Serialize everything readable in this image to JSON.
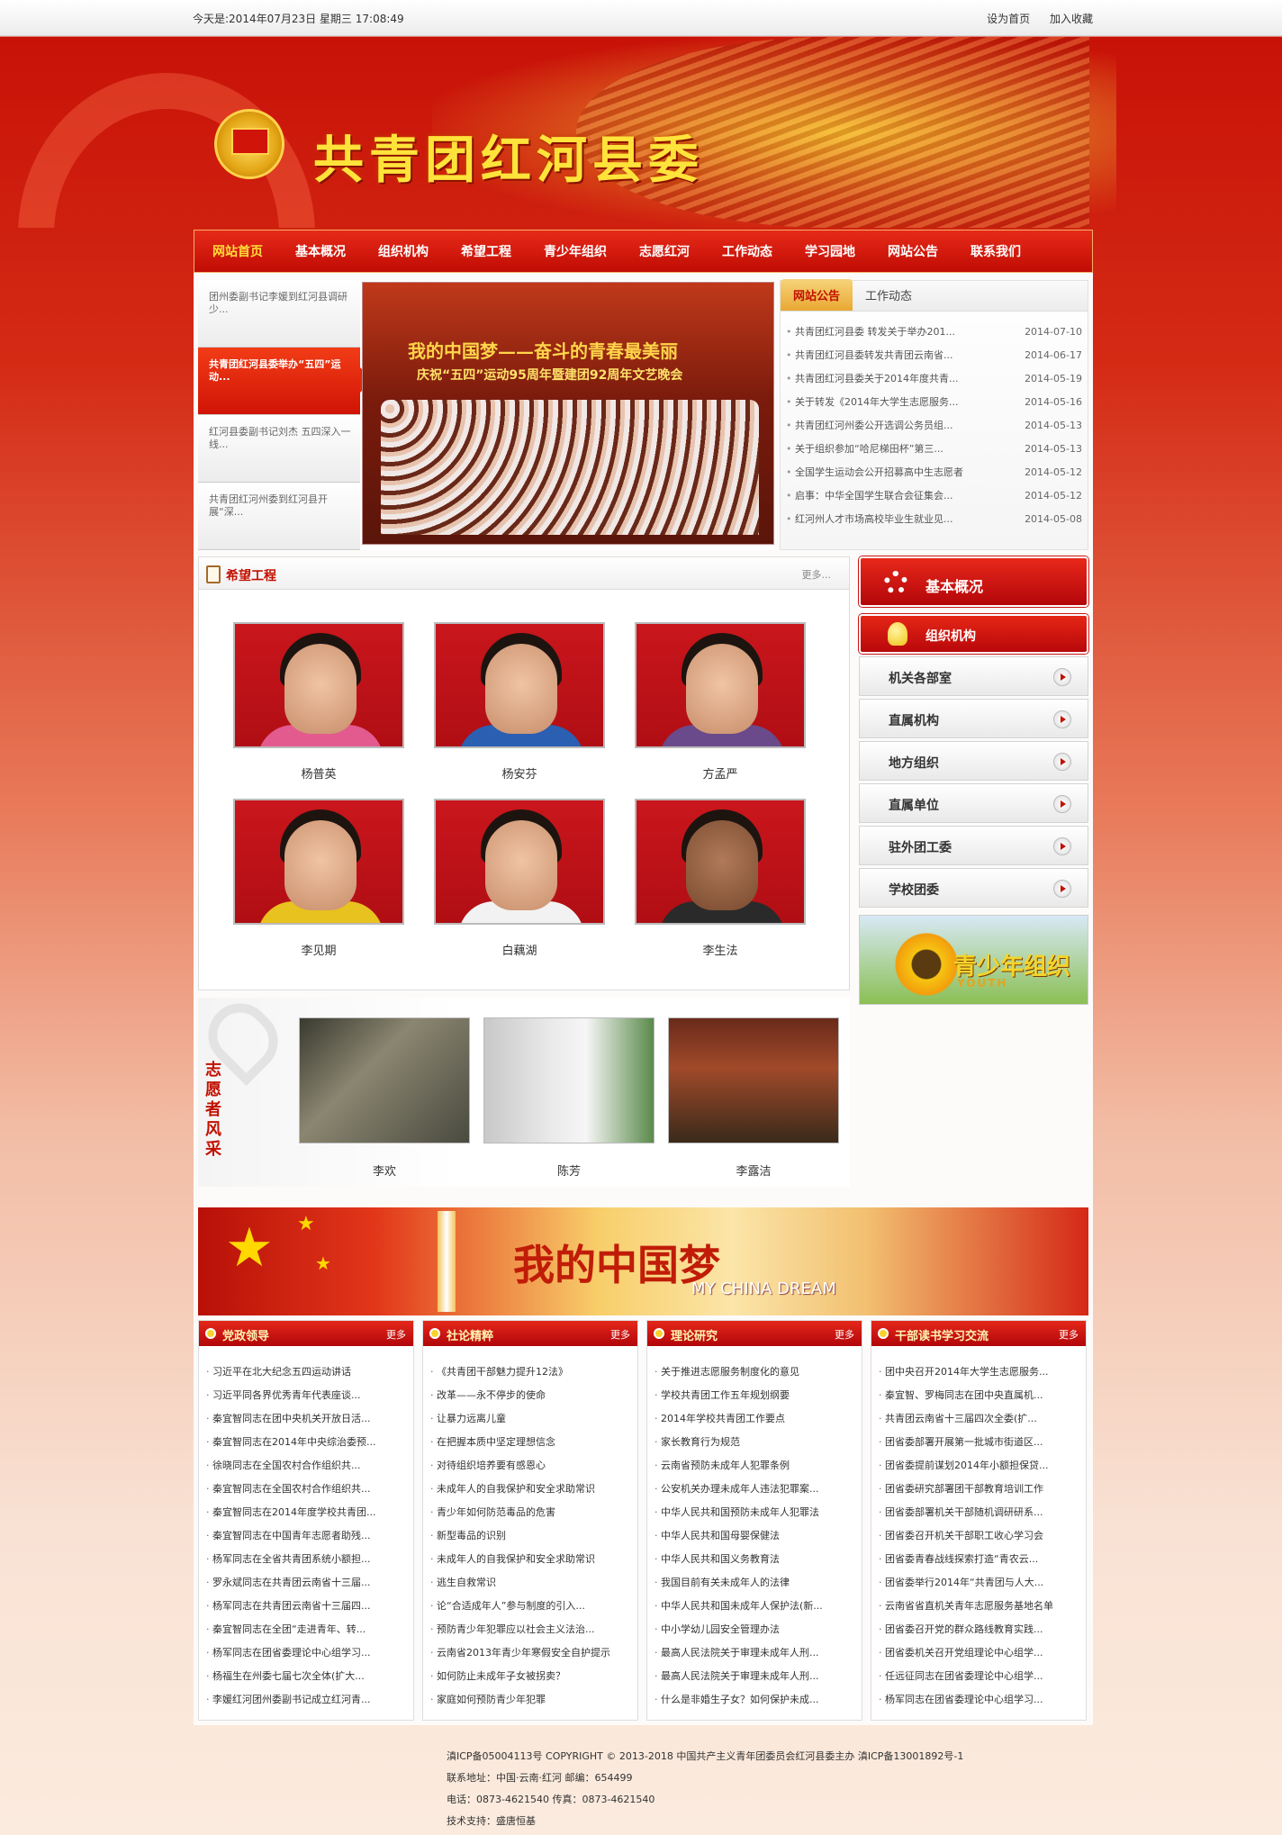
{
  "topbar": {
    "date": "今天是:2014年07月23日  星期三  17:08:49",
    "set_home": "设为首页",
    "add_fav": "加入收藏"
  },
  "banner": {
    "title": "共青团红河县委"
  },
  "nav": [
    "网站首页",
    "基本概况",
    "组织机构",
    "希望工程",
    "青少年组织",
    "志愿红河",
    "工作动态",
    "学习园地",
    "网站公告",
    "联系我们"
  ],
  "slider": {
    "thumbs": [
      "团州委副书记李媛到红河县调研少...",
      "共青团红河县委举办“五四”运动...",
      "红河县委副书记刘杰 五四深入一线...",
      "共青团红河州委到红河县开展“深..."
    ],
    "slogan": "我的中国梦——奋斗的青春最美丽",
    "subslogan": "庆祝“五四”运动95周年暨建团92周年文艺晚会"
  },
  "notice": {
    "tabs": [
      "网站公告",
      "工作动态"
    ],
    "items": [
      {
        "t": "共青团红河县委 转发关于举办201...",
        "d": "2014-07-10"
      },
      {
        "t": "共青团红河县委转发共青团云南省...",
        "d": "2014-06-17"
      },
      {
        "t": "共青团红河县委关于2014年度共青...",
        "d": "2014-05-19"
      },
      {
        "t": "关于转发《2014年大学生志愿服务...",
        "d": "2014-05-16"
      },
      {
        "t": "共青团红河州委公开选调公务员组...",
        "d": "2014-05-13"
      },
      {
        "t": "关于组织参加“哈尼梯田杯”第三...",
        "d": "2014-05-13"
      },
      {
        "t": "全国学生运动会公开招募高中生志愿者",
        "d": "2014-05-12"
      },
      {
        "t": "启事：中华全国学生联合会征集会...",
        "d": "2014-05-12"
      },
      {
        "t": "红河州人才市场高校毕业生就业见...",
        "d": "2014-05-08"
      }
    ]
  },
  "hope": {
    "title": "希望工程",
    "more": "更多...",
    "kids": [
      "杨普英",
      "杨安芬",
      "方孟严",
      "李见期",
      "白藕湖",
      "李生法"
    ]
  },
  "volunteer": {
    "label": "志愿者风采",
    "people": [
      "李欢",
      "陈芳",
      "李露洁"
    ]
  },
  "side": {
    "basic": "基本概况",
    "org": "组织机构",
    "items": [
      "机关各部室",
      "直属机构",
      "地方组织",
      "直属单位",
      "驻外团工委",
      "学校团委"
    ],
    "youth": "青少年组织",
    "youth_en": "YOUTH"
  },
  "dream": {
    "title": "我的中国梦",
    "en": "MY CHINA DREAM"
  },
  "columns": [
    {
      "title": "党政领导",
      "more": "更多",
      "items": [
        "习近平在北大纪念五四运动讲话",
        "习近平同各界优秀青年代表座谈...",
        "秦宜智同志在团中央机关开放日活...",
        "秦宜智同志在2014年中央综治委预...",
        "徐晓同志在全国农村合作组织共...",
        "秦宜智同志在全国农村合作组织共...",
        "秦宜智同志在2014年度学校共青团...",
        "秦宜智同志在中国青年志愿者助残...",
        "杨军同志在全省共青团系统小额担...",
        "罗永斌同志在共青团云南省十三届...",
        "杨军同志在共青团云南省十三届四...",
        "秦宜智同志在全团“走进青年、转...",
        "杨军同志在团省委理论中心组学习...",
        "杨福生在州委七届七次全体(扩大...",
        "李媛红河团州委副书记成立红河青..."
      ]
    },
    {
      "title": "社论精粹",
      "more": "更多",
      "items": [
        "《共青团干部魅力提升12法》",
        "改革——永不停步的使命",
        "让暴力远离儿童",
        "在把握本质中坚定理想信念",
        "对待组织培养要有感恩心",
        "未成年人的自我保护和安全求助常识",
        "青少年如何防范毒品的危害",
        "新型毒品的识别",
        "未成年人的自我保护和安全求助常识",
        "逃生自救常识",
        "论“合适成年人”参与制度的引入...",
        "预防青少年犯罪应以社会主义法治...",
        "云南省2013年青少年寒假安全自护提示",
        "如何防止未成年子女被拐卖？",
        "家庭如何预防青少年犯罪"
      ]
    },
    {
      "title": "理论研究",
      "more": "更多",
      "items": [
        "关于推进志愿服务制度化的意见",
        "学校共青团工作五年规划纲要",
        "2014年学校共青团工作要点",
        "家长教育行为规范",
        "云南省预防未成年人犯罪条例",
        "公安机关办理未成年人违法犯罪案...",
        "中华人民共和国预防未成年人犯罪法",
        "中华人民共和国母婴保健法",
        "中华人民共和国义务教育法",
        "我国目前有关未成年人的法律",
        "中华人民共和国未成年人保护法(新...",
        "中小学幼儿园安全管理办法",
        "最高人民法院关于审理未成年人刑...",
        "最高人民法院关于审理未成年人刑...",
        "什么是非婚生子女？如何保护未成..."
      ]
    },
    {
      "title": "干部读书学习交流",
      "more": "更多",
      "items": [
        "团中央召开2014年大学生志愿服务...",
        "秦宜智、罗梅同志在团中央直属机...",
        "共青团云南省十三届四次全委(扩...",
        "团省委部署开展第一批城市街道区...",
        "团省委提前谋划2014年小额担保贷...",
        "团省委研究部署团干部教育培训工作",
        "团省委部署机关干部随机调研研系...",
        "团省委召开机关干部职工收心学习会",
        "团省委青春战线探索打造“青农云...",
        "团省委举行2014年“共青团与人大...",
        "云南省省直机关青年志愿服务基地名单",
        "团省委召开党的群众路线教育实践...",
        "团省委机关召开党组理论中心组学...",
        "任远征同志在团省委理论中心组学...",
        "杨军同志在团省委理论中心组学习..."
      ]
    }
  ],
  "footer": {
    "line1": "滇ICP备05004113号 COPYRIGHT © 2013-2018 中国共产主义青年团委员会红河县委主办 滇ICP备13001892号-1",
    "line2": "联系地址：中国·云南·红河   邮编：654499",
    "line3": "电话：0873-4621540   传真：0873-4621540",
    "line4": "技术支持：盛唐恒基"
  }
}
